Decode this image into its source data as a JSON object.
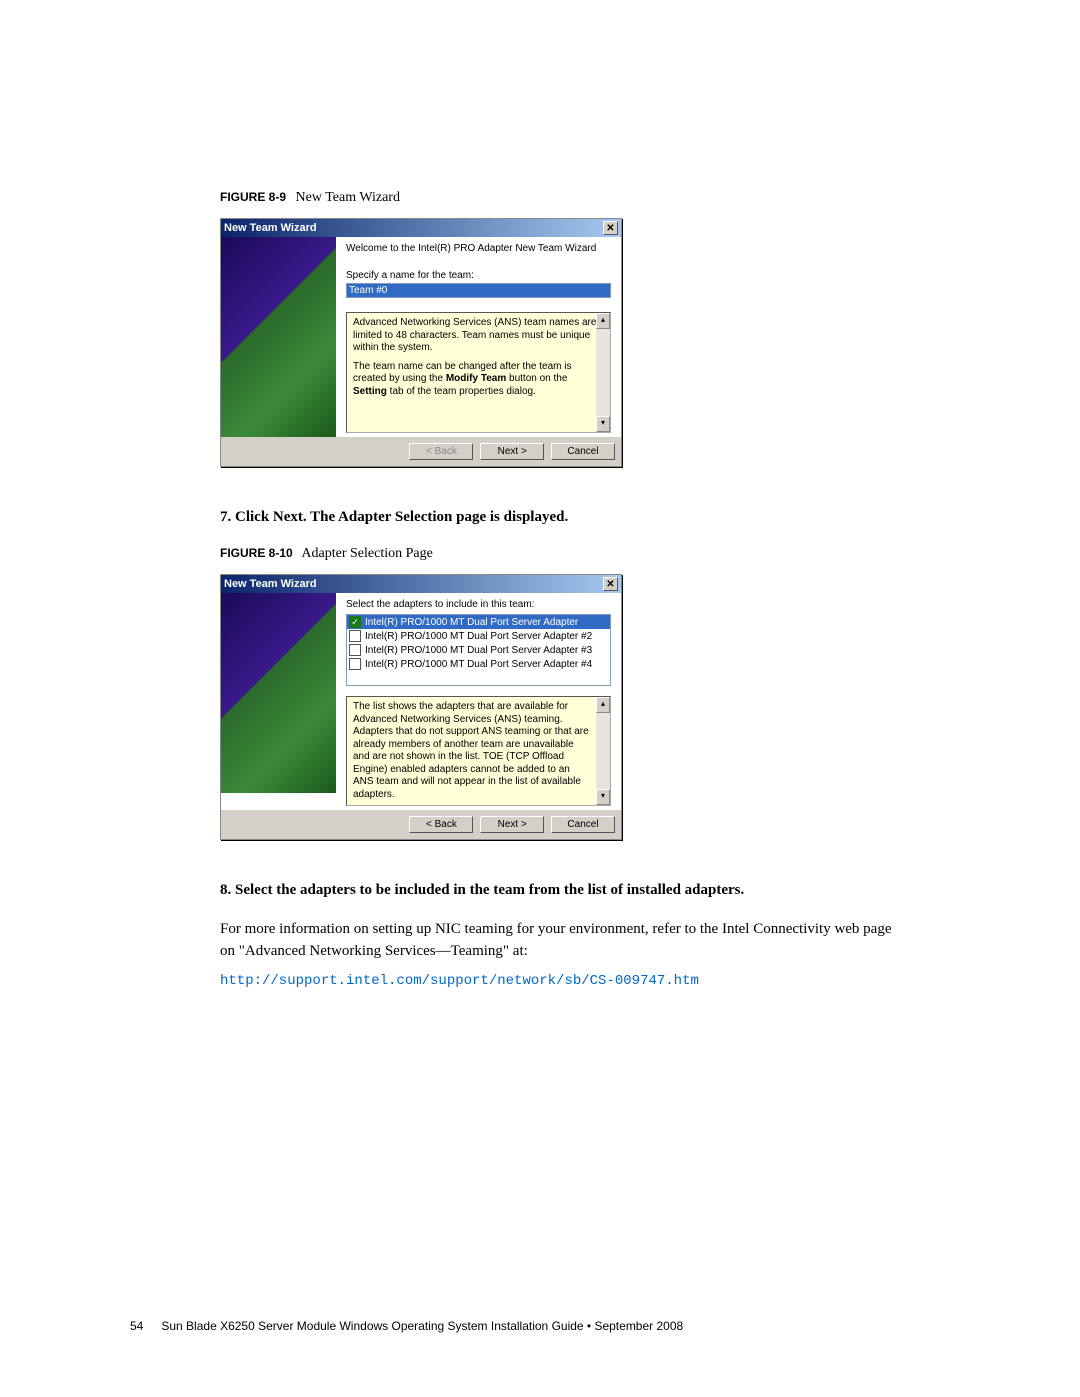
{
  "fig1": {
    "label": "FIGURE 8-9",
    "title": "New Team Wizard"
  },
  "wiz1": {
    "title": "New Team Wizard",
    "welcome": "Welcome to the Intel(R) PRO Adapter New Team Wizard",
    "specify_label": "Specify a name for the team:",
    "input_value": "Team #0",
    "info1": "Advanced Networking Services (ANS) team names are limited to 48 characters. Team names must be unique within the system.",
    "info2_a": "The team name can be changed after the team is created by using the ",
    "info2_b": "Modify Team",
    "info2_c": " button on the ",
    "info2_d": "Setting",
    "info2_e": " tab of the team properties dialog.",
    "btn_back": "< Back",
    "btn_next": "Next >",
    "btn_cancel": "Cancel"
  },
  "step7": "7.  Click Next. The Adapter Selection page is displayed.",
  "fig2": {
    "label": "FIGURE 8-10",
    "title": "Adapter Selection Page"
  },
  "wiz2": {
    "title": "New Team Wizard",
    "select_label": "Select the adapters to include in this team:",
    "adapters": [
      "Intel(R) PRO/1000 MT Dual Port Server Adapter",
      "Intel(R) PRO/1000 MT Dual Port Server Adapter #2",
      "Intel(R) PRO/1000 MT Dual Port Server Adapter #3",
      "Intel(R) PRO/1000 MT Dual Port Server Adapter #4"
    ],
    "info": "The list shows the adapters that are available for Advanced Networking Services (ANS) teaming. Adapters that do not support ANS teaming or that are already members of another team are unavailable and are not shown in the list. TOE (TCP Offload Engine) enabled adapters cannot be added to an ANS team and will not appear in the list of available adapters.",
    "btn_back": "< Back",
    "btn_next": "Next >",
    "btn_cancel": "Cancel"
  },
  "step8": "8.  Select the adapters to be included in the team from the list of installed adapters.",
  "para": "For more information on setting up NIC teaming for your environment, refer to the Intel Connectivity web page on \"Advanced Networking Services—Teaming\" at:",
  "url": "http://support.intel.com/support/network/sb/CS-009747.htm",
  "footer": {
    "page": "54",
    "text": "Sun Blade X6250 Server Module Windows Operating System Installation Guide  •  September 2008"
  }
}
